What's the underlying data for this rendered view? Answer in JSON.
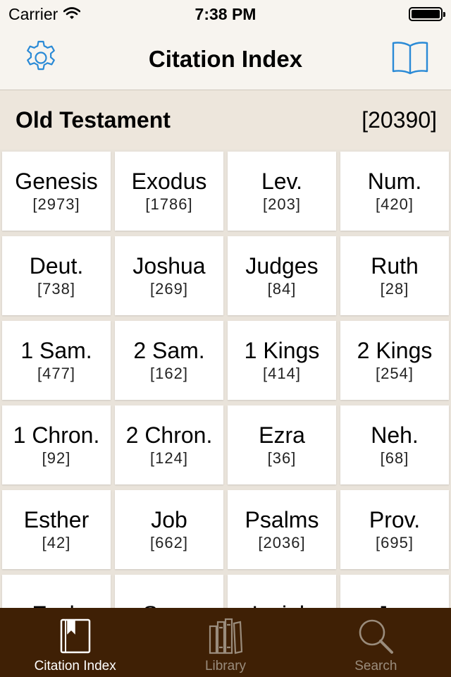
{
  "status_bar": {
    "carrier": "Carrier",
    "time": "7:38 PM"
  },
  "nav": {
    "title": "Citation Index",
    "left_icon": "gear-icon",
    "right_icon": "book-icon",
    "accent_color": "#2a8ad6"
  },
  "section": {
    "title": "Old Testament",
    "count": "[20390]"
  },
  "books": [
    {
      "name": "Genesis",
      "count": "[2973]"
    },
    {
      "name": "Exodus",
      "count": "[1786]"
    },
    {
      "name": "Lev.",
      "count": "[203]"
    },
    {
      "name": "Num.",
      "count": "[420]"
    },
    {
      "name": "Deut.",
      "count": "[738]"
    },
    {
      "name": "Joshua",
      "count": "[269]"
    },
    {
      "name": "Judges",
      "count": "[84]"
    },
    {
      "name": "Ruth",
      "count": "[28]"
    },
    {
      "name": "1 Sam.",
      "count": "[477]"
    },
    {
      "name": "2 Sam.",
      "count": "[162]"
    },
    {
      "name": "1 Kings",
      "count": "[414]"
    },
    {
      "name": "2 Kings",
      "count": "[254]"
    },
    {
      "name": "1 Chron.",
      "count": "[92]"
    },
    {
      "name": "2 Chron.",
      "count": "[124]"
    },
    {
      "name": "Ezra",
      "count": "[36]"
    },
    {
      "name": "Neh.",
      "count": "[68]"
    },
    {
      "name": "Esther",
      "count": "[42]"
    },
    {
      "name": "Job",
      "count": "[662]"
    },
    {
      "name": "Psalms",
      "count": "[2036]"
    },
    {
      "name": "Prov.",
      "count": "[695]"
    },
    {
      "name": "Eccl.",
      "count": ""
    },
    {
      "name": "Song",
      "count": ""
    },
    {
      "name": "Isaiah",
      "count": ""
    },
    {
      "name": "Jer.",
      "count": ""
    }
  ],
  "tabs": [
    {
      "label": "Citation Index",
      "icon": "bookmark-book-icon",
      "active": true
    },
    {
      "label": "Library",
      "icon": "library-books-icon",
      "active": false
    },
    {
      "label": "Search",
      "icon": "magnifier-icon",
      "active": false
    }
  ],
  "colors": {
    "tab_bar": "#3f2005",
    "tab_active": "#ffffff",
    "tab_inactive": "#9a8c7c"
  }
}
